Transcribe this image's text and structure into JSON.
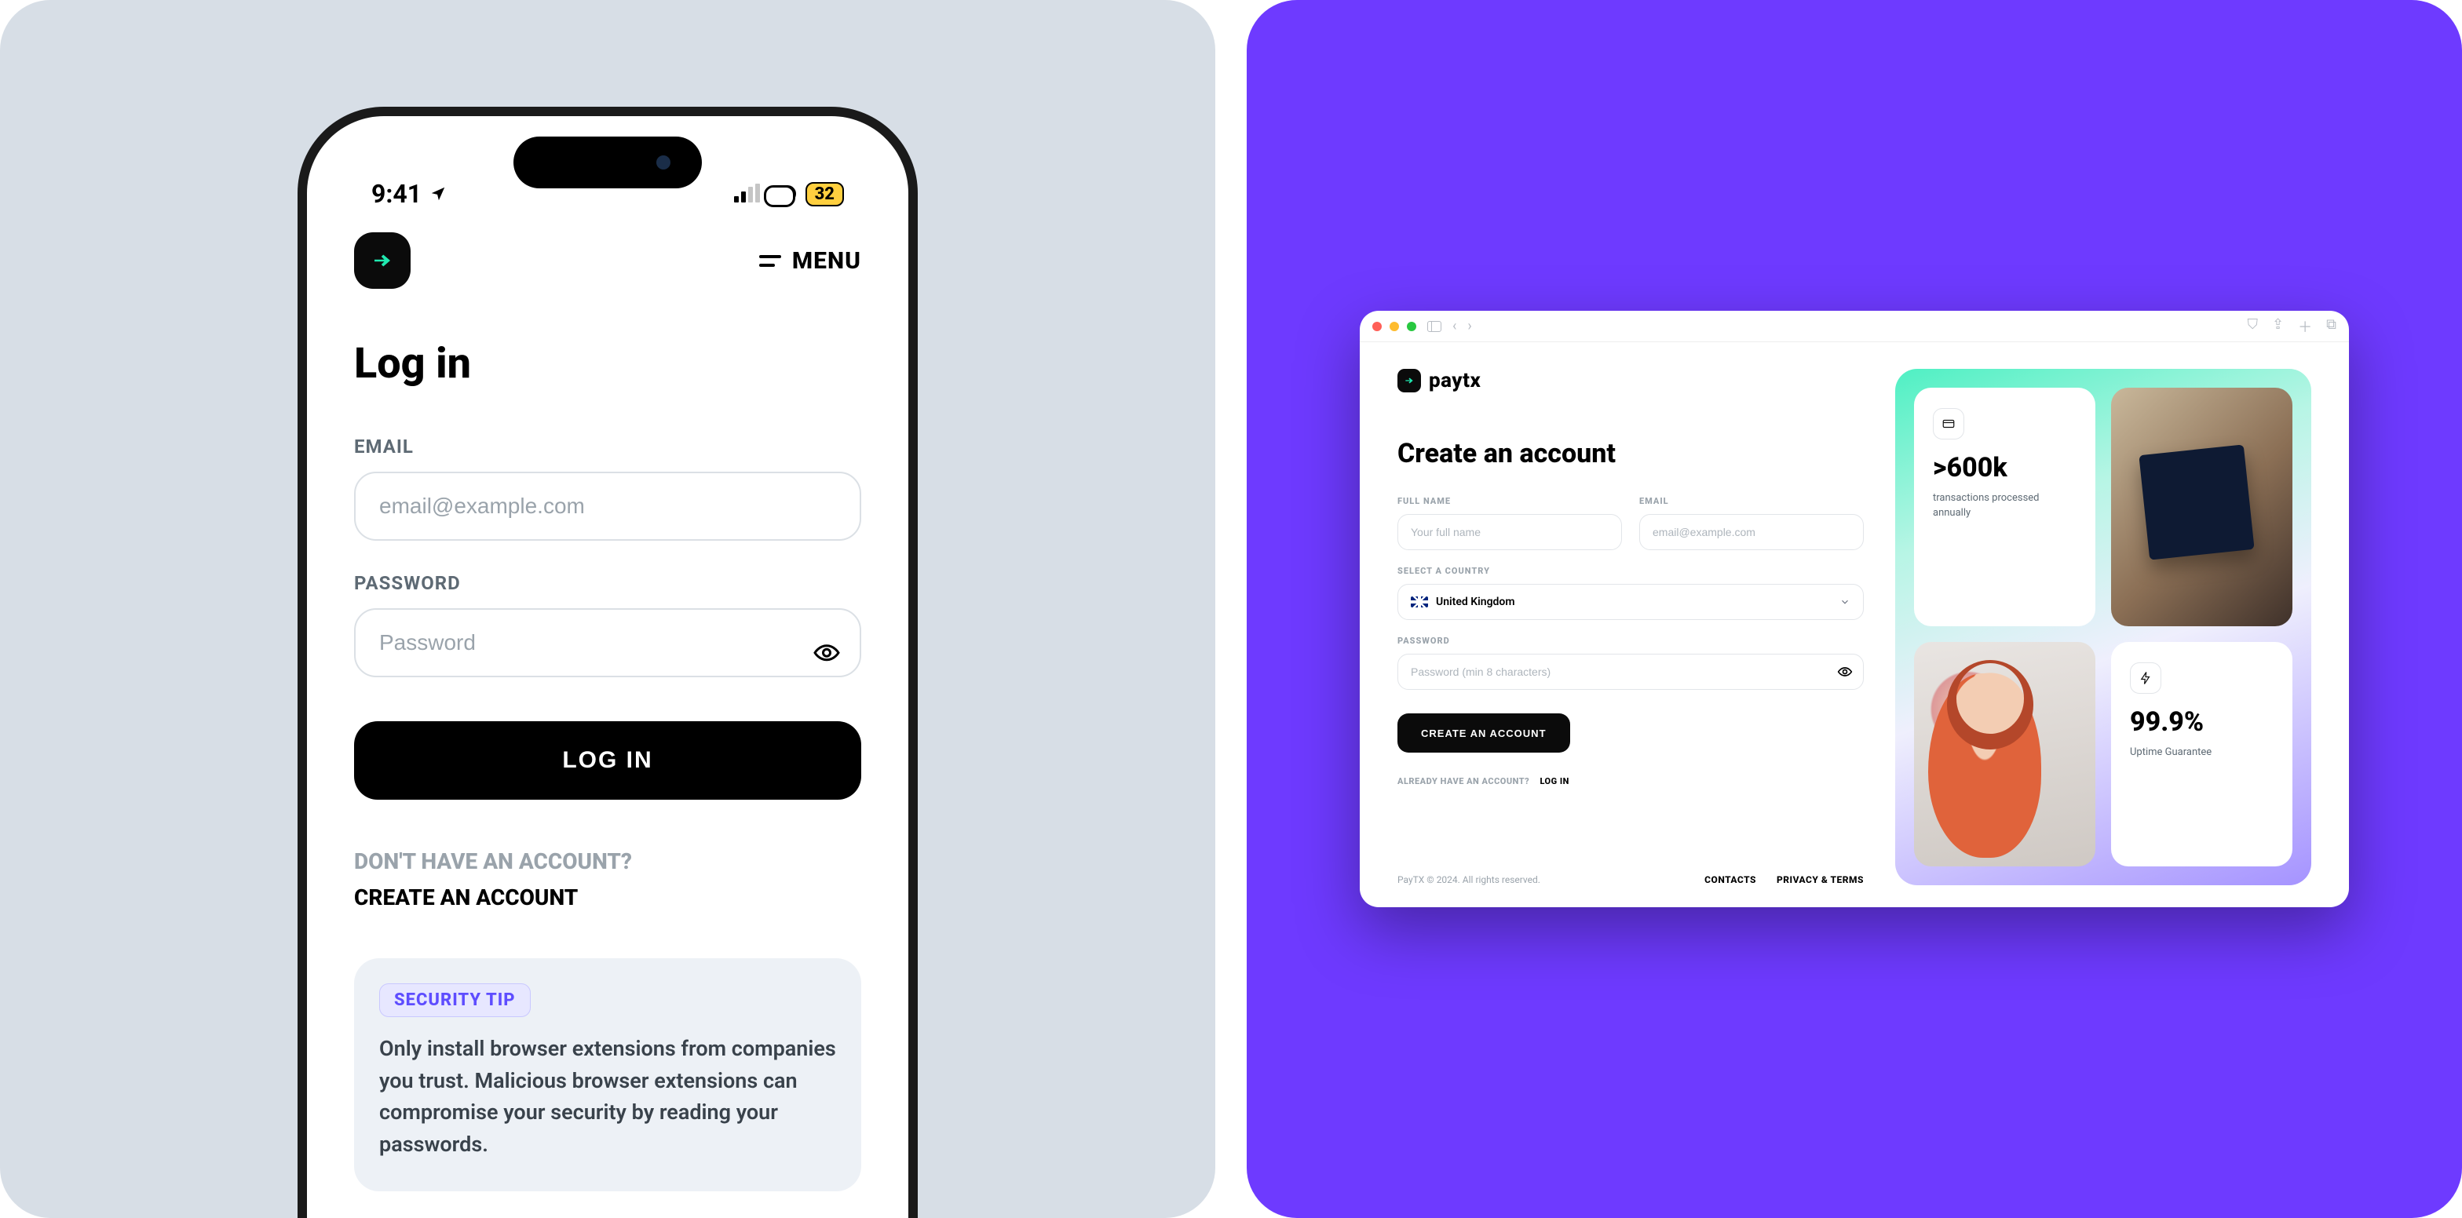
{
  "mobile": {
    "status": {
      "time": "9:41",
      "battery": "32"
    },
    "menu_label": "MENU",
    "title": "Log in",
    "email_label": "EMAIL",
    "email_placeholder": "email@example.com",
    "password_label": "PASSWORD",
    "password_placeholder": "Password",
    "login_button": "LOG IN",
    "no_account_text": "DON'T HAVE AN ACCOUNT?",
    "create_account_link": "CREATE AN ACCOUNT",
    "tip_badge": "SECURITY TIP",
    "tip_body": "Only install browser extensions from companies you trust. Malicious browser extensions can compromise your security by reading your passwords."
  },
  "desktop": {
    "brand": "paytx",
    "title": "Create an account",
    "fullname_label": "FULL NAME",
    "fullname_placeholder": "Your full name",
    "email_label": "EMAIL",
    "email_placeholder": "email@example.com",
    "country_label": "SELECT A COUNTRY",
    "country_value": "United Kingdom",
    "password_label": "PASSWORD",
    "password_placeholder": "Password (min 8 characters)",
    "create_button": "CREATE AN ACCOUNT",
    "already_text": "ALREADY HAVE AN ACCOUNT?",
    "login_link": "LOG IN",
    "footer_copyright": "PayTX © 2024. All rights reserved.",
    "footer_contacts": "CONTACTS",
    "footer_privacy": "PRIVACY & TERMS",
    "promo": {
      "stat1_value": ">600k",
      "stat1_caption": "transactions processed annually",
      "stat2_value": "99.9%",
      "stat2_caption": "Uptime Guarantee"
    }
  }
}
